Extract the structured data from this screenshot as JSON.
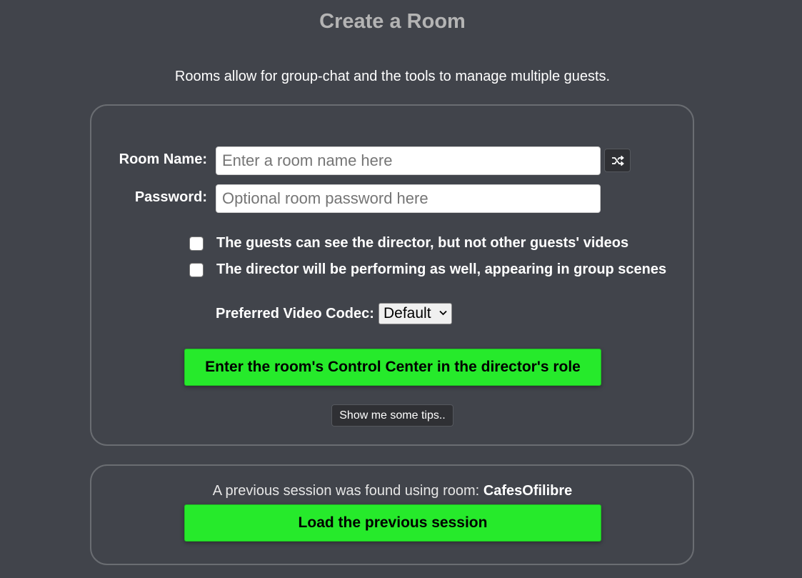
{
  "header": {
    "title": "Create a Room",
    "subtitle": "Rooms allow for group-chat and the tools to manage multiple guests."
  },
  "form": {
    "room_name_label": "Room Name:",
    "room_name_value": "",
    "room_name_placeholder": "Enter a room name here",
    "password_label": "Password:",
    "password_value": "",
    "password_placeholder": "Optional room password here",
    "shuffle_icon": "shuffle-icon",
    "checkboxes": [
      {
        "label": "The guests can see the director, but not other guests' videos",
        "checked": false
      },
      {
        "label": "The director will be performing as well, appearing in group scenes",
        "checked": false
      }
    ],
    "codec_label": "Preferred Video Codec:",
    "codec_selected": "Default",
    "enter_button": "Enter the room's Control Center in the director's role",
    "tips_button": "Show me some tips.."
  },
  "previous": {
    "text_prefix": "A previous session was found using room:",
    "room_name": "CafesOfilibre",
    "load_button": "Load the previous session"
  },
  "colors": {
    "background": "#41444b",
    "accent_green": "#26ea2b",
    "title_gray": "#b4b4b4"
  }
}
